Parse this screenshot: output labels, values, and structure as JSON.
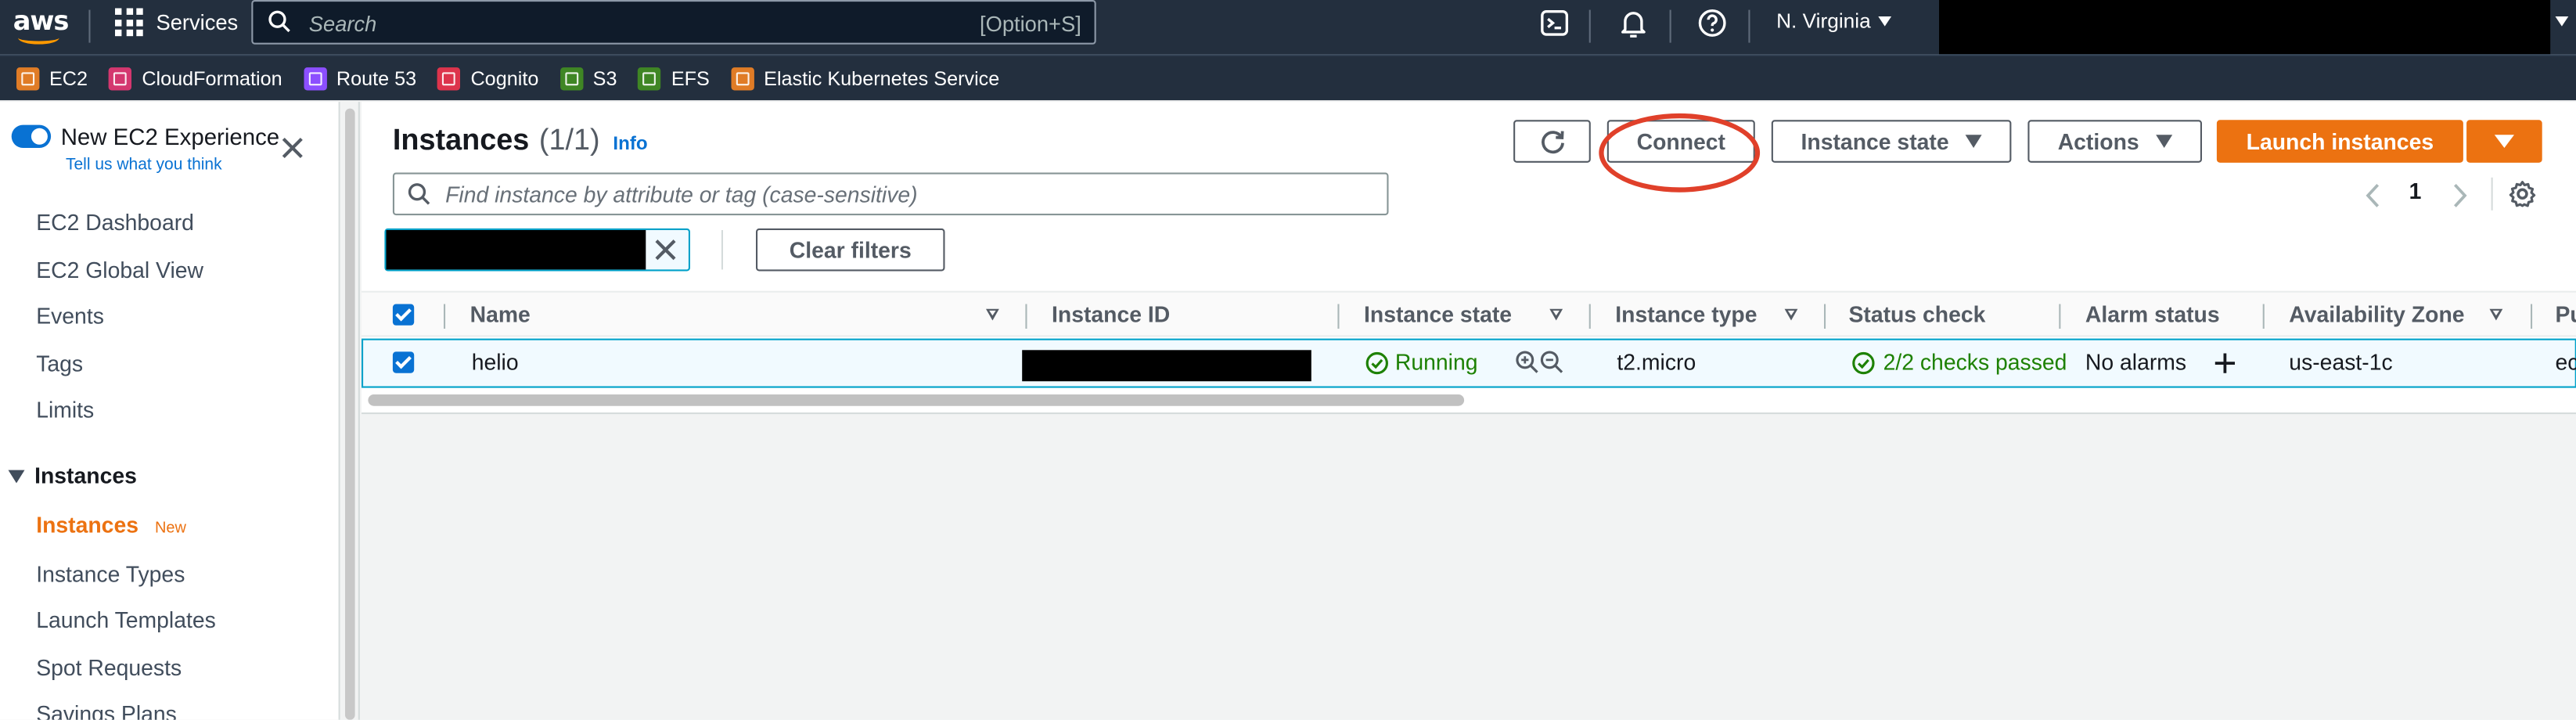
{
  "topnav": {
    "logo_text": "aws",
    "services_label": "Services",
    "search_placeholder": "Search",
    "search_shortcut": "[Option+S]",
    "region": "N. Virginia"
  },
  "favorites": [
    {
      "label": "EC2",
      "color": "#e07c26"
    },
    {
      "label": "CloudFormation",
      "color": "#d4376f"
    },
    {
      "label": "Route 53",
      "color": "#8c4fff"
    },
    {
      "label": "Cognito",
      "color": "#dd344c"
    },
    {
      "label": "S3",
      "color": "#3f8624"
    },
    {
      "label": "EFS",
      "color": "#3f8624"
    },
    {
      "label": "Elastic Kubernetes Service",
      "color": "#e07c26"
    }
  ],
  "sidebar": {
    "new_experience": "New EC2 Experience",
    "tell_us": "Tell us what you think",
    "items_top": [
      "EC2 Dashboard",
      "EC2 Global View",
      "Events",
      "Tags",
      "Limits"
    ],
    "section": "Instances",
    "active_item": "Instances",
    "active_badge": "New",
    "items_bottom": [
      "Instance Types",
      "Launch Templates",
      "Spot Requests",
      "Savings Plans"
    ]
  },
  "main": {
    "title": "Instances",
    "count": "(1/1)",
    "info": "Info",
    "connect": "Connect",
    "instance_state_btn": "Instance state",
    "actions_btn": "Actions",
    "launch_btn": "Launch instances",
    "filter_placeholder": "Find instance by attribute or tag (case-sensitive)",
    "page_number": "1",
    "clear_filters": "Clear filters"
  },
  "table": {
    "headers": [
      "Name",
      "Instance ID",
      "Instance state",
      "Instance type",
      "Status check",
      "Alarm status",
      "Availability Zone",
      "Pu"
    ],
    "row": {
      "name": "helio",
      "state": "Running",
      "type": "t2.micro",
      "status_check": "2/2 checks passed",
      "alarm": "No alarms",
      "az": "us-east-1c",
      "public": "ec"
    }
  }
}
